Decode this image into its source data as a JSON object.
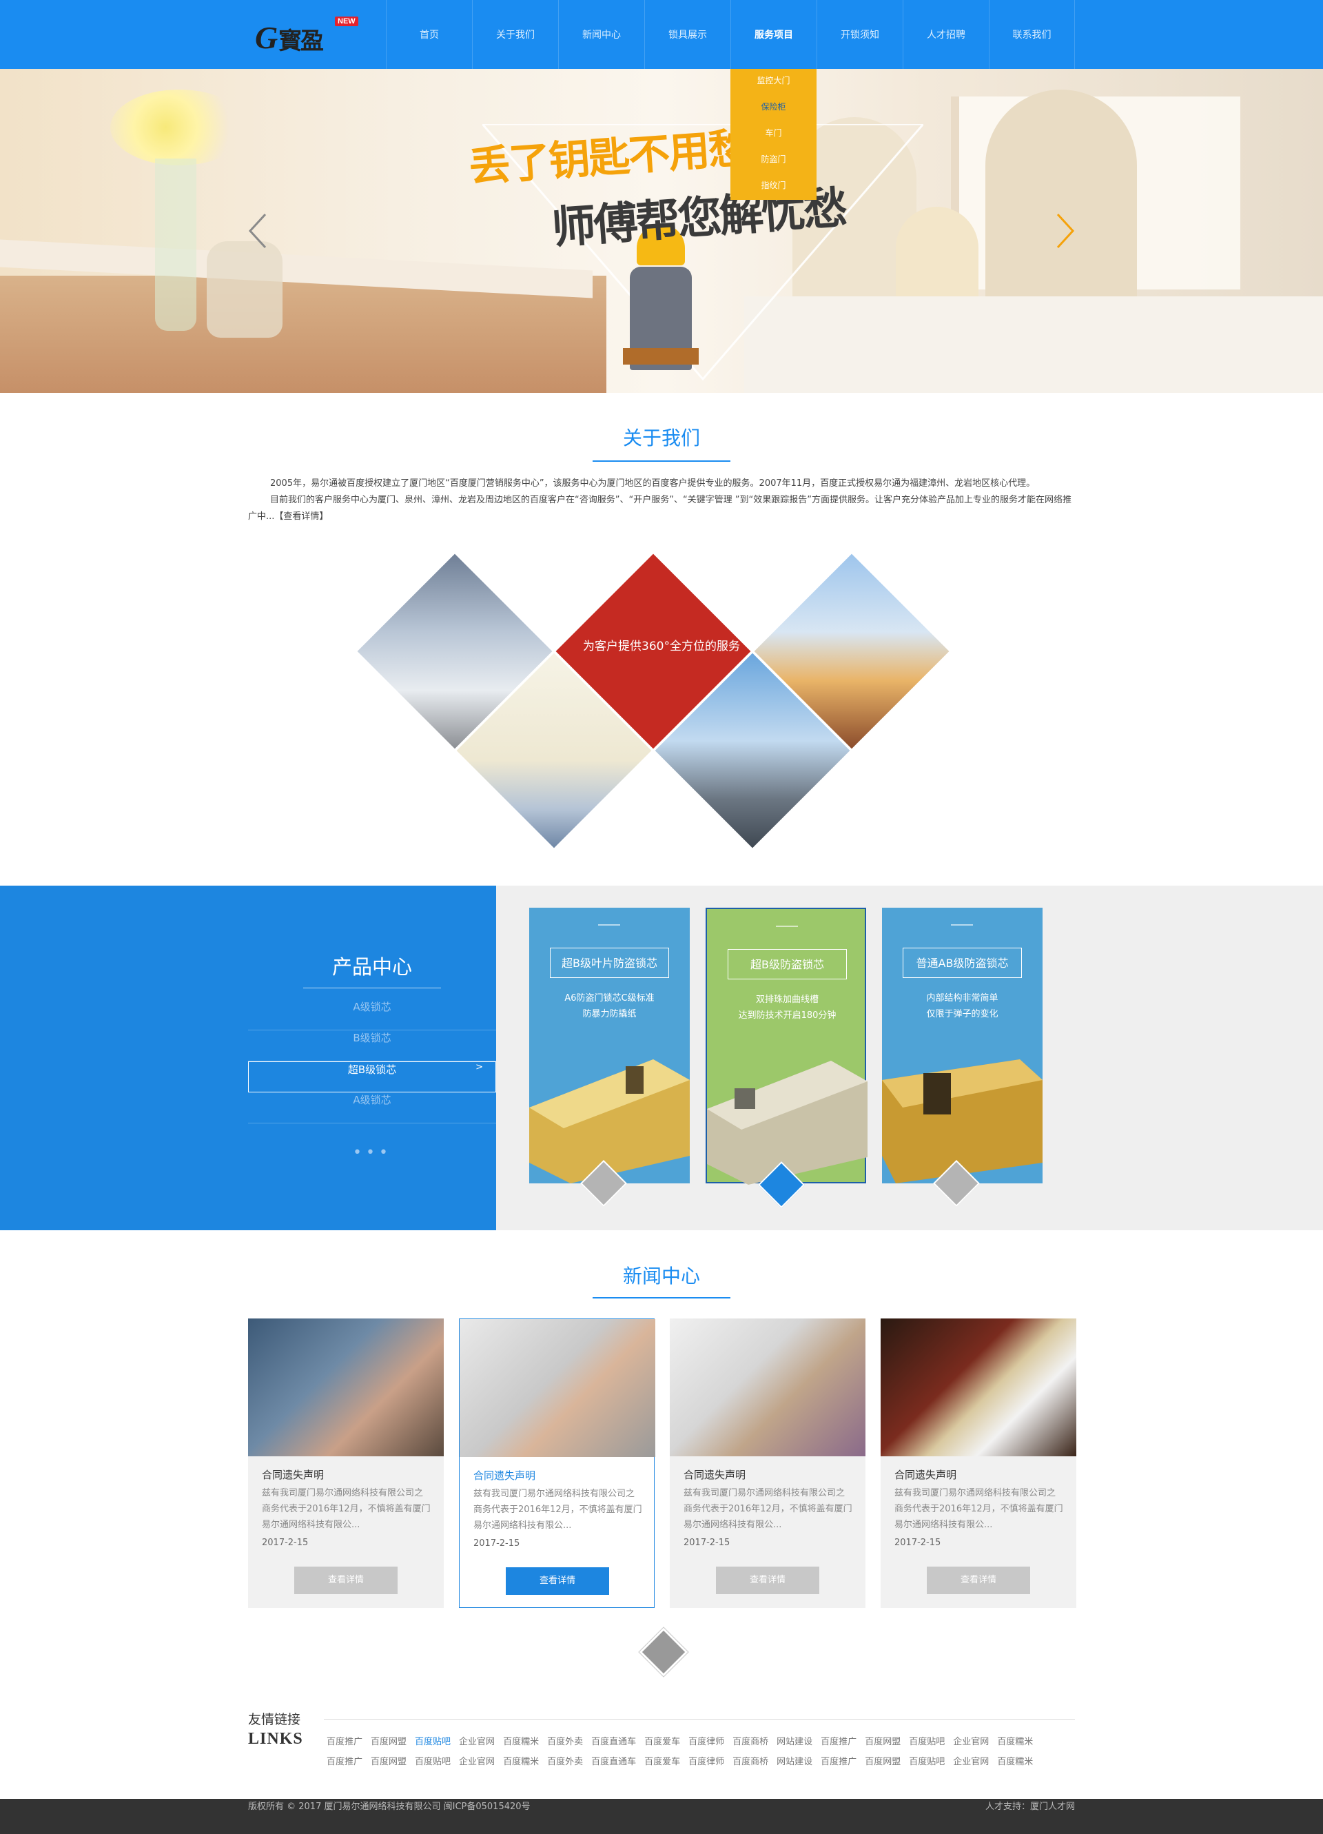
{
  "header": {
    "logo_new": "NEW",
    "nav": [
      "首页",
      "关于我们",
      "新闻中心",
      "锁具展示",
      "服务项目",
      "开锁须知",
      "人才招聘",
      "联系我们"
    ],
    "dropdown": [
      "监控大门",
      "保险柜",
      "车门",
      "防盗门",
      "指纹门"
    ]
  },
  "banner": {
    "slogan1": "丢了钥匙不用愁",
    "slogan2": "师傅帮您解忧愁",
    "qmark": "?"
  },
  "about": {
    "title": "关于我们",
    "p1": "2005年，易尔通被百度授权建立了厦门地区“百度厦门营销服务中心”，该服务中心为厦门地区的百度客户提供专业的服务。2007年11月，百度正式授权易尔通为福建漳州、龙岩地区核心代理。",
    "p2": "目前我们的客户服务中心为厦门、泉州、漳州、龙岩及周边地区的百度客户在“咨询服务”、“开户服务”、“关键字管理 ”到“效果跟踪报告”方面提供服务。让客户充分体验产品加上专业的服务才能在网络推广中...【查看详情】",
    "diamond_text": "为客户提供360°全方位的服务"
  },
  "product": {
    "title": "产品中心",
    "categories": [
      "A级锁芯",
      "B级锁芯",
      "超B级锁芯",
      "A级锁芯"
    ],
    "active_marker": ">",
    "dots": "•••",
    "cards": [
      {
        "label": "超B级叶片防盗锁芯",
        "desc1": "A6防盗门锁芯C级标准",
        "desc2": "防暴力防撬纸"
      },
      {
        "label": "超B级防盗锁芯",
        "desc1": "双排珠加曲线槽",
        "desc2": "达到防技术开启180分钟"
      },
      {
        "label": "普通AB级防盗锁芯",
        "desc1": "内部结构非常简单",
        "desc2": "仅限于弹子的变化"
      }
    ],
    "colors": {
      "card1": "#4fa3d6",
      "card2": "#9cc86a",
      "card3": "#4fa3d6"
    }
  },
  "news": {
    "title": "新闻中心",
    "items": [
      {
        "title": "合同遗失声明",
        "body": "兹有我司厦门易尔通网络科技有限公司之商务代表于2016年12月，不慎将盖有厦门易尔通网络科技有限公...",
        "date": "2017-2-15",
        "more": "查看详情"
      },
      {
        "title": "合同遗失声明",
        "body": "兹有我司厦门易尔通网络科技有限公司之商务代表于2016年12月，不慎将盖有厦门易尔通网络科技有限公...",
        "date": "2017-2-15",
        "more": "查看详情"
      },
      {
        "title": "合同遗失声明",
        "body": "兹有我司厦门易尔通网络科技有限公司之商务代表于2016年12月，不慎将盖有厦门易尔通网络科技有限公...",
        "date": "2017-2-15",
        "more": "查看详情"
      },
      {
        "title": "合同遗失声明",
        "body": "兹有我司厦门易尔通网络科技有限公司之商务代表于2016年12月，不慎将盖有厦门易尔通网络科技有限公...",
        "date": "2017-2-15",
        "more": "查看详情"
      }
    ]
  },
  "links": {
    "title": "友情链接",
    "en": "LINKS",
    "row1": [
      "百度推广",
      "百度网盟",
      "百度贴吧",
      "企业官网",
      "百度糯米",
      "百度外卖",
      "百度直通车",
      "百度爱车",
      "百度律师",
      "百度商桥",
      "网站建设",
      "百度推广",
      "百度网盟",
      "百度贴吧",
      "企业官网",
      "百度糯米"
    ],
    "row2": [
      "百度推广",
      "百度网盟",
      "百度贴吧",
      "企业官网",
      "百度糯米",
      "百度外卖",
      "百度直通车",
      "百度爱车",
      "百度律师",
      "百度商桥",
      "网站建设",
      "百度推广",
      "百度网盟",
      "百度贴吧",
      "企业官网",
      "百度糯米"
    ]
  },
  "footer": {
    "copyright": "版权所有 © 2017 厦门易尔通网络科技有限公司  闽ICP备05015420号",
    "support": "人才支持：厦门人才网"
  }
}
